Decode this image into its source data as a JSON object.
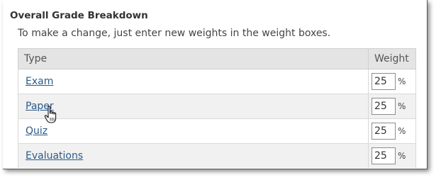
{
  "section": {
    "title": "Overall Grade Breakdown",
    "instructions": "To make a change, just enter new weights in the weight boxes."
  },
  "table": {
    "headers": {
      "type": "Type",
      "weight": "Weight"
    },
    "rows": [
      {
        "type": "Exam",
        "weight": "25",
        "unit": "%"
      },
      {
        "type": "Paper",
        "weight": "25",
        "unit": "%"
      },
      {
        "type": "Quiz",
        "weight": "25",
        "unit": "%"
      },
      {
        "type": "Evaluations",
        "weight": "25",
        "unit": "%"
      }
    ]
  },
  "cursor": {
    "icon": "hand-pointer-icon"
  },
  "colors": {
    "link": "#2c5b8c",
    "header_bg": "#e4e4e4",
    "alt_row_bg": "#f1f1f1"
  }
}
